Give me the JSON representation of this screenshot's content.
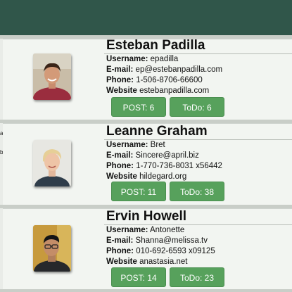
{
  "users": [
    {
      "name": "Esteban Padilla",
      "username_label": "Username:",
      "username": "epadilla",
      "email_label": "E-mail:",
      "email": "ep@estebanpadilla.com",
      "phone_label": "Phone:",
      "phone": "1-506-8706-66600",
      "website_label": "Website",
      "website": "estebanpadilla.com",
      "posts_label": "POST: 6",
      "todos_label": "ToDo: 6"
    },
    {
      "name": "Leanne Graham",
      "username_label": "Username:",
      "username": "Bret",
      "email_label": "E-mail:",
      "email": "Sincere@april.biz",
      "phone_label": "Phone:",
      "phone": "1-770-736-8031 x56442",
      "website_label": "Website",
      "website": "hildegard.org",
      "posts_label": "POST: 11",
      "todos_label": "ToDo: 38"
    },
    {
      "name": "Ervin Howell",
      "username_label": "Username:",
      "username": "Antonette",
      "email_label": "E-mail:",
      "email": "Shanna@melissa.tv",
      "phone_label": "Phone:",
      "phone": "010-692-6593 x09125",
      "website_label": "Website",
      "website": "anastasia.net",
      "posts_label": "POST: 14",
      "todos_label": "ToDo: 23"
    }
  ],
  "colors": {
    "header": "#30564a",
    "button": "#57a15c",
    "card_background": "#f2f5f1"
  },
  "icons": [
    "avatar-photo"
  ]
}
